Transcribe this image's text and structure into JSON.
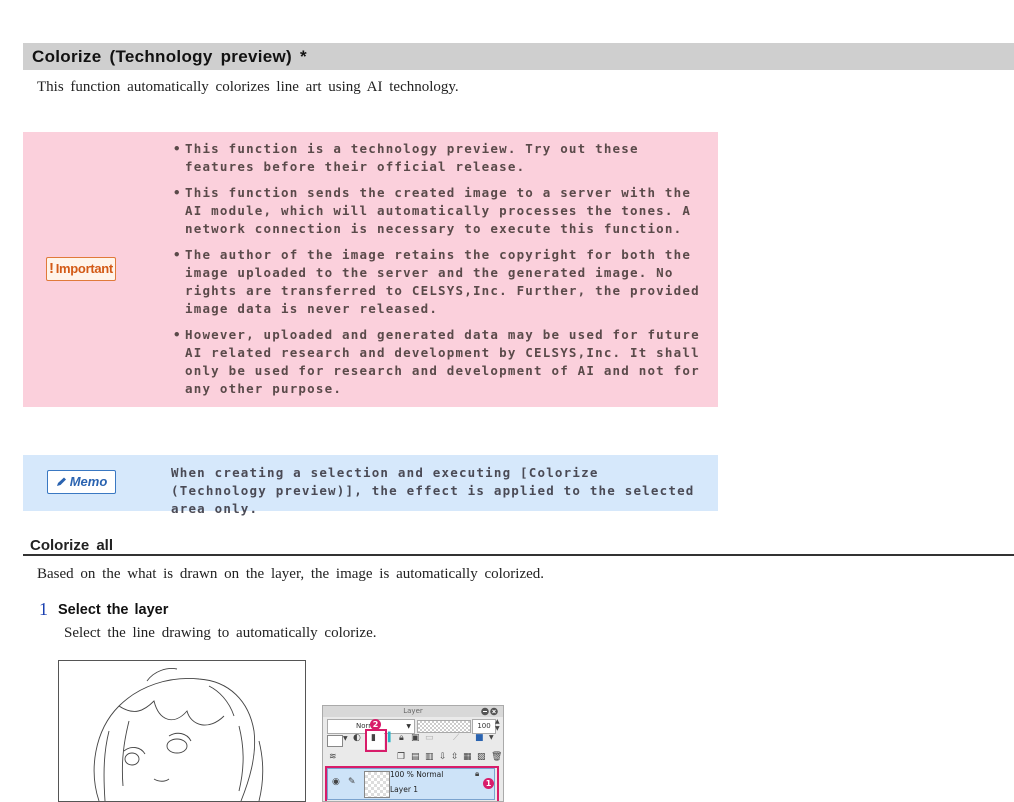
{
  "header": {
    "title": "Colorize (Technology preview) *"
  },
  "intro": "This function automatically colorizes line art using AI technology.",
  "important": {
    "badge_label": "Important",
    "badge_icon": "!",
    "items": [
      "This function is a technology preview. Try out these features before their official release.",
      "This function sends the created image to a server with the AI module, which will automatically processes the tones. A network connection is necessary to execute this function.",
      "The author of the image retains the copyright for both the image uploaded to the server and the generated image. No rights are transferred to CELSYS,Inc. Further, the provided image data is never released.",
      "However, uploaded and generated data may be used for future AI related research and development by CELSYS,Inc. It shall only be used for research and development of AI and not for any other purpose."
    ]
  },
  "memo": {
    "badge_label": "Memo",
    "badge_icon": "pencil-icon",
    "text": "When creating a selection and executing [Colorize (Technology preview)], the effect is applied to the selected area only."
  },
  "section": {
    "title": "Colorize all",
    "description": "Based on the what is drawn on the layer, the image is automatically colorized."
  },
  "step": {
    "number": "1",
    "title": "Select the layer",
    "description": "Select the line drawing to automatically colorize."
  },
  "layer_panel": {
    "title": "Layer",
    "blend_mode": "Norm",
    "opacity": "100",
    "badge_1": "1",
    "badge_2": "2",
    "layer_opacity_mode": "100 % Normal",
    "layer_name": "Layer 1"
  },
  "colors": {
    "important_bg": "#fbd0dc",
    "memo_bg": "#d6e8fb",
    "header_bg": "#cfcfcf",
    "step_number": "#1a3fb0",
    "highlight": "#d81c6a"
  }
}
